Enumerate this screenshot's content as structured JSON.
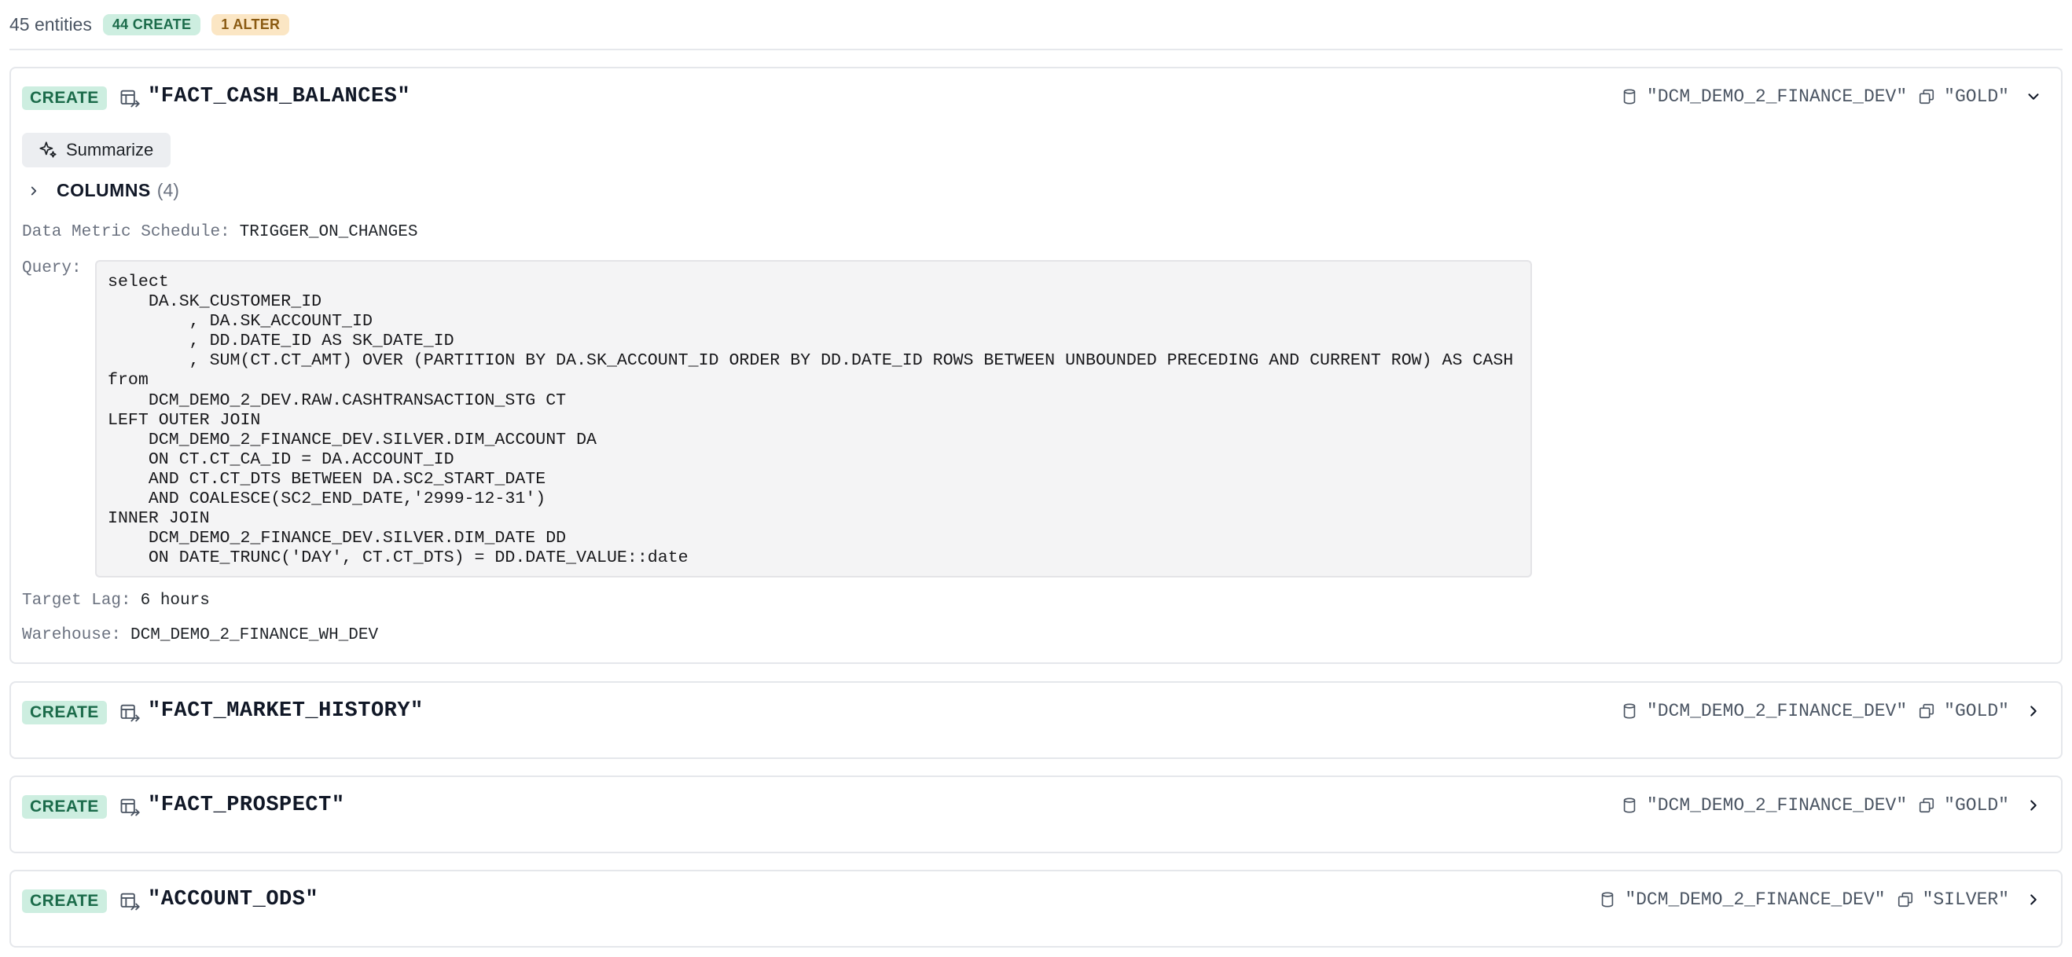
{
  "summary": {
    "entities": "45 entities",
    "create_badge": "44 CREATE",
    "alter_badge": "1 ALTER"
  },
  "expanded": {
    "action": "CREATE",
    "name": "\"FACT_CASH_BALANCES\"",
    "database": "\"DCM_DEMO_2_FINANCE_DEV\"",
    "schema": "\"GOLD\"",
    "summarize_label": "Summarize",
    "columns_label": "COLUMNS",
    "columns_count": "(4)",
    "dms_label": "Data Metric Schedule:",
    "dms_value": "TRIGGER_ON_CHANGES",
    "query_label": "Query:",
    "query": "select\n    DA.SK_CUSTOMER_ID\n        , DA.SK_ACCOUNT_ID\n        , DD.DATE_ID AS SK_DATE_ID\n        , SUM(CT.CT_AMT) OVER (PARTITION BY DA.SK_ACCOUNT_ID ORDER BY DD.DATE_ID ROWS BETWEEN UNBOUNDED PRECEDING AND CURRENT ROW) AS CASH\nfrom\n    DCM_DEMO_2_DEV.RAW.CASHTRANSACTION_STG CT\nLEFT OUTER JOIN\n    DCM_DEMO_2_FINANCE_DEV.SILVER.DIM_ACCOUNT DA\n    ON CT.CT_CA_ID = DA.ACCOUNT_ID\n    AND CT.CT_DTS BETWEEN DA.SC2_START_DATE\n    AND COALESCE(SC2_END_DATE,'2999-12-31')\nINNER JOIN\n    DCM_DEMO_2_FINANCE_DEV.SILVER.DIM_DATE DD\n    ON DATE_TRUNC('DAY', CT.CT_DTS) = DD.DATE_VALUE::date",
    "target_lag_label": "Target Lag:",
    "target_lag_value": "6 hours",
    "warehouse_label": "Warehouse:",
    "warehouse_value": "DCM_DEMO_2_FINANCE_WH_DEV"
  },
  "collapsed": [
    {
      "action": "CREATE",
      "name": "\"FACT_MARKET_HISTORY\"",
      "database": "\"DCM_DEMO_2_FINANCE_DEV\"",
      "schema": "\"GOLD\""
    },
    {
      "action": "CREATE",
      "name": "\"FACT_PROSPECT\"",
      "database": "\"DCM_DEMO_2_FINANCE_DEV\"",
      "schema": "\"GOLD\""
    },
    {
      "action": "CREATE",
      "name": "\"ACCOUNT_ODS\"",
      "database": "\"DCM_DEMO_2_FINANCE_DEV\"",
      "schema": "\"SILVER\""
    }
  ],
  "icons": {
    "table": "dynamic-table-icon",
    "database": "database-icon",
    "schema": "schema-icon",
    "summarize": "sparkle-icon",
    "expand": "chevron-down-icon",
    "collapse": "chevron-right-icon"
  },
  "colors": {
    "create_bg": "#cdeee0",
    "create_fg": "#1b6b4a",
    "alter_bg": "#fbe6c4",
    "alter_fg": "#8a5a12"
  }
}
